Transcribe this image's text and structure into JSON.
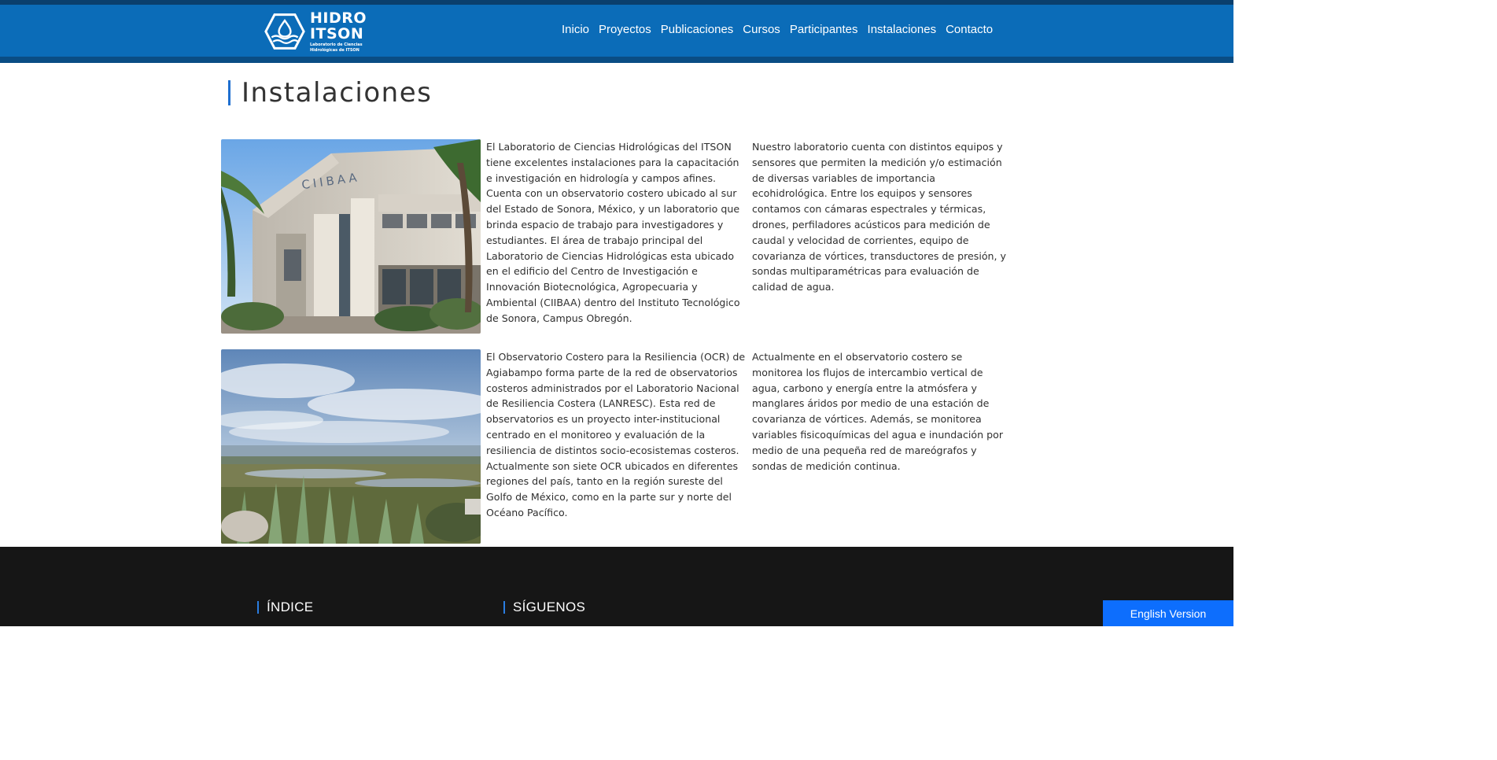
{
  "header": {
    "logo": {
      "title_line1": "HIDRO",
      "title_line2": "ITSON",
      "subtitle_line1": "Laboratorio de Ciencias",
      "subtitle_line2": "Hidrológicas de ITSON"
    },
    "nav": [
      "Inicio",
      "Proyectos",
      "Publicaciones",
      "Cursos",
      "Participantes",
      "Instalaciones",
      "Contacto"
    ]
  },
  "main": {
    "title": "Instalaciones",
    "sections": [
      {
        "image": "building-photo",
        "sign_text": "CIIBAA",
        "text_left": "El Laboratorio de Ciencias Hidrológicas del ITSON tiene excelentes instalaciones para la capacitación e investigación en hidrología y campos afines. Cuenta con un observatorio costero ubicado al sur del Estado de Sonora, México, y un laboratorio que brinda espacio de trabajo para investigadores y estudiantes. El área de trabajo principal del Laboratorio de Ciencias Hidrológicas esta ubicado en el edificio del Centro de Investigación e Innovación Biotecnológica, Agropecuaria y Ambiental (CIIBAA) dentro del Instituto Tecnológico de Sonora, Campus Obregón.",
        "text_right": "Nuestro laboratorio cuenta con distintos equipos y sensores que permiten la medición y/o estimación de diversas variables de importancia ecohidrológica. Entre los equipos y sensores contamos con cámaras espectrales y térmicas, drones, perfiladores acústicos para medición de caudal y velocidad de corrientes, equipo de covarianza de vórtices, transductores de presión, y sondas multiparamétricas para evaluación de calidad de agua."
      },
      {
        "image": "coastal-landscape-photo",
        "text_left": "El Observatorio Costero para la Resiliencia (OCR) de Agiabampo forma parte de la red de observatorios costeros administrados por el Laboratorio Nacional de Resiliencia Costera (LANRESC). Esta red de observatorios es un proyecto inter-institucional centrado en el monitoreo y evaluación de la resiliencia de distintos socio-ecosistemas costeros. Actualmente son siete OCR ubicados en diferentes regiones del país, tanto en la región sureste del Golfo de México, como en la parte sur y norte del Océano Pacífico.",
        "text_right": "Actualmente en el observatorio costero se monitorea los flujos de intercambio vertical de agua, carbono y energía entre la atmósfera y manglares áridos por medio de una estación de covarianza de vórtices. Además, se monitorea variables fisicoquímicas del agua e inundación por medio de una pequeña red de mareógrafos y sondas de medición continua."
      }
    ]
  },
  "footer": {
    "index_heading": "ÍNDICE",
    "follow_heading": "SÍGUENOS"
  },
  "language_button": "English Version",
  "colors": {
    "header": "#0b6cb8",
    "header_dark": "#0a4d84",
    "accent": "#1f6fd0",
    "footer": "#161616",
    "button": "#0d6efd"
  }
}
